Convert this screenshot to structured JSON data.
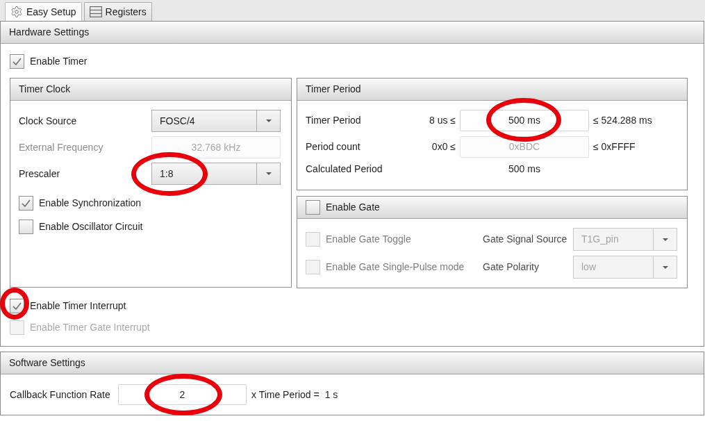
{
  "tabs": [
    {
      "label": "Easy Setup",
      "selected": true
    },
    {
      "label": "Registers",
      "selected": false
    }
  ],
  "hardware_settings": {
    "title": "Hardware Settings",
    "enable_timer": {
      "label": "Enable Timer",
      "checked": true
    },
    "timer_clock": {
      "title": "Timer Clock",
      "fields": [
        {
          "kind": "combo",
          "label": "Clock Source",
          "value": "FOSC/4",
          "disabled": false,
          "circled": false
        },
        {
          "kind": "text",
          "label": "External Frequency",
          "value": "32.768 kHz",
          "disabled": true,
          "circled": false
        },
        {
          "kind": "combo",
          "label": "Prescaler",
          "value": "1:8",
          "disabled": false,
          "circled": true
        }
      ],
      "options": [
        {
          "label": "Enable Synchronization",
          "checked": true
        },
        {
          "label": "Enable Oscillator Circuit",
          "checked": false
        }
      ]
    },
    "timer_period": {
      "title": "Timer Period",
      "rows": [
        {
          "kind": "field",
          "label": "Timer Period",
          "min": "8 us ≤",
          "value": "500 ms",
          "max": "≤ 524.288 ms",
          "disabled": false,
          "circled": true
        },
        {
          "kind": "field",
          "label": "Period count",
          "min": "0x0 ≤",
          "value": "0xBDC",
          "max": "≤ 0xFFFF",
          "disabled": true,
          "circled": false
        },
        {
          "kind": "reading",
          "label": "Calculated Period",
          "value": "500 ms"
        }
      ]
    },
    "gate": {
      "label": "Enable Gate",
      "checked": false,
      "rows": [
        {
          "option": {
            "label": "Enable Gate Toggle",
            "checked": false,
            "disabled": true
          },
          "select": {
            "label": "Gate Signal Source",
            "value": "T1G_pin",
            "disabled": true
          }
        },
        {
          "option": {
            "label": "Enable Gate Single-Pulse mode",
            "checked": false,
            "disabled": true
          },
          "select": {
            "label": "Gate Polarity",
            "value": "low",
            "disabled": true
          }
        }
      ]
    },
    "interrupts": [
      {
        "label": "Enable Timer Interrupt",
        "checked": true,
        "disabled": false,
        "circled": true
      },
      {
        "label": "Enable Timer Gate Interrupt",
        "checked": false,
        "disabled": true,
        "circled": false
      }
    ]
  },
  "software_settings": {
    "title": "Software Settings",
    "callback": {
      "label": "Callback Function Rate",
      "value": "2",
      "suffix": "x Time Period =",
      "result": "1 s",
      "circled": true
    }
  }
}
